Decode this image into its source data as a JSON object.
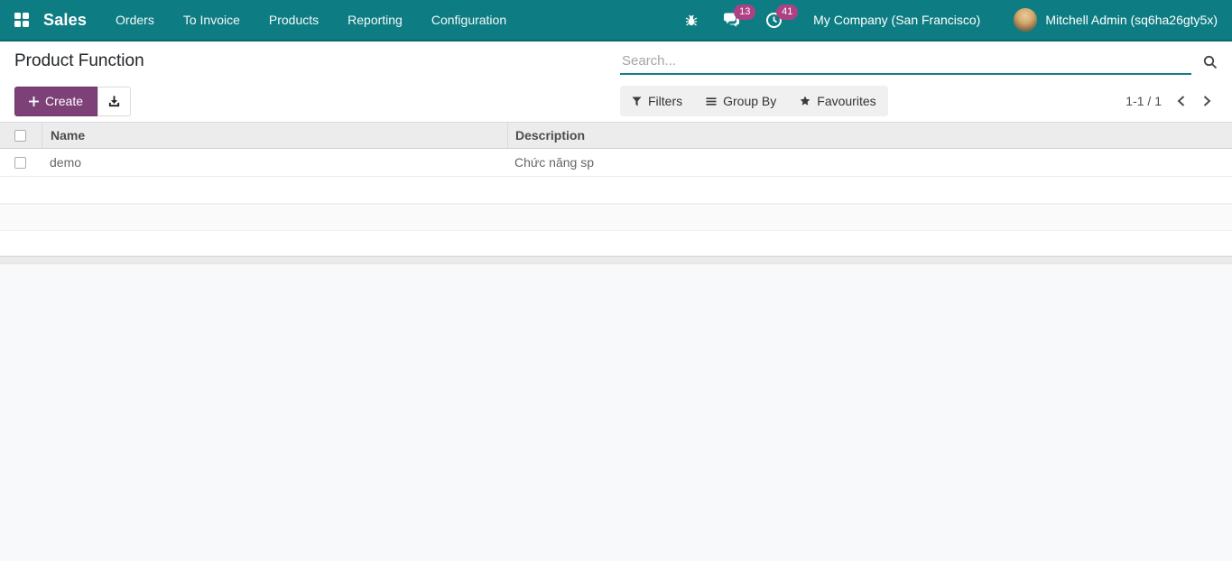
{
  "navbar": {
    "app_label": "Sales",
    "menu_items": [
      "Orders",
      "To Invoice",
      "Products",
      "Reporting",
      "Configuration"
    ],
    "messages_badge": "13",
    "activities_badge": "41",
    "company": "My Company (San Francisco)",
    "user": "Mitchell Admin (sq6ha26gty5x)"
  },
  "control_panel": {
    "title": "Product Function",
    "create_label": "Create",
    "search_placeholder": "Search...",
    "filters_label": "Filters",
    "group_by_label": "Group By",
    "favourites_label": "Favourites",
    "pager": "1-1 / 1"
  },
  "table": {
    "columns": [
      "Name",
      "Description"
    ],
    "rows": [
      {
        "name": "demo",
        "description": "Chức năng sp"
      }
    ]
  },
  "icons": {
    "apps": "grid-icon",
    "debug": "bug-icon",
    "messages": "chat-bubbles-icon",
    "activities": "clock-icon",
    "search": "magnifier-icon",
    "create": "plus-icon",
    "export": "download-icon",
    "filters": "funnel-icon",
    "group_by": "bars-icon",
    "favourites": "star-icon",
    "pager_prev": "chevron-left-icon",
    "pager_next": "chevron-right-icon"
  },
  "colors": {
    "navbar_bg": "#0e7d83",
    "badge_bg": "#ad4184",
    "create_button_bg": "#7d4178",
    "search_underline": "#11808a",
    "page_bg": "#f8f9fa"
  }
}
